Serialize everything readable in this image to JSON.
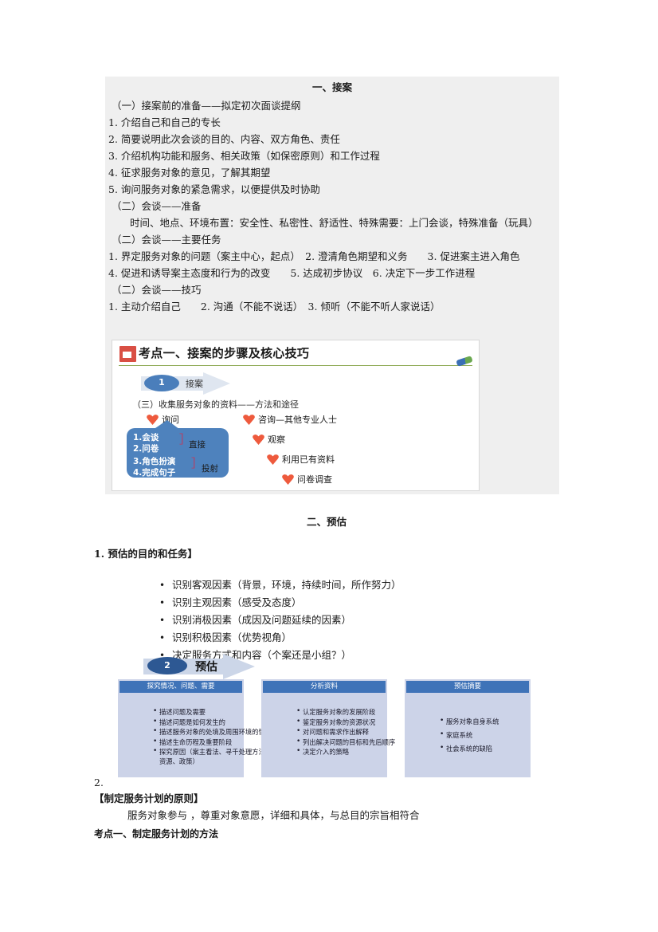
{
  "section1": {
    "title": "一、接案",
    "lines": [
      "（一）接案前的准备——拟定初次面谈提纲",
      "1. 介绍自己和自己的专长",
      "2. 简要说明此次会谈的目的、内容、双方角色、责任",
      "3. 介绍机构功能和服务、相关政策（如保密原则）和工作过程",
      "4. 征求服务对象的意见，了解其期望",
      "5. 询问服务对象的紧急需求，以便提供及时协助",
      "（二）会谈——准备",
      "时间、地点、环境布置：安全性、私密性、舒适性、特殊需要：上门会谈，特殊准备（玩具）",
      "（二）会谈——主要任务",
      "1. 界定服务对象的问题（案主中心，起点）　2. 澄清角色期望和义务　　3. 促进案主进入角色",
      "4. 促进和诱导案主态度和行为的改变　　5. 达成初步协议　6. 决定下一步工作进程",
      "（二）会谈——技巧",
      "1. 主动介绍自己　　2. 沟通（不能不说话）　3. 倾听（不能不听人家说话）"
    ]
  },
  "slide1": {
    "title": "考点一、接案的步骤及核心技巧",
    "step_number": "1",
    "step_label": "接案",
    "subtitle": "（三）收集服务对象的资料——方法和途径",
    "heart_items": [
      "询问",
      "咨询—其他专业人士",
      "观察",
      "利用已有资料",
      "问卷调查"
    ],
    "callout": {
      "lines": [
        "1.会谈",
        "2.问卷",
        "3.角色扮演",
        "4.完成句子"
      ],
      "bracket_glyph": "］",
      "side_labels": [
        "直接",
        "投射"
      ]
    }
  },
  "section2": {
    "title": "二、预估",
    "heading": "1. 预估的目的和任务】",
    "bullets": [
      "识别客观因素（背景，环境，持续时间，所作努力）",
      "识别主观因素（感受及态度）",
      "识别消极因素（成因及问题延续的因素）",
      "识别积极因素（优势视角）",
      "决定服务方式和内容（个案还是小组？）"
    ]
  },
  "slide2": {
    "step_number": "2",
    "step_label": "预估",
    "columns": [
      {
        "header": "探究情况、问题、需要",
        "items": [
          "描述问题及需要",
          "描述问题是如何发生的",
          "描述服务对象的处境及周围环境的情况",
          "描述生命历程及重要阶段",
          "探究原因（案主看法、寻千处理方法、资源、政策）"
        ]
      },
      {
        "header": "分析资料",
        "items": [
          "认定服务对象的发展阶段",
          "鉴定服务对象的资源状况",
          "对问题和需求作出解释",
          "列出解决问题的目标和先后顺序",
          "决定介入的策略"
        ]
      },
      {
        "header": "预估摘要",
        "items": [
          "服务对象自身系统",
          "家庭系统",
          "社会系统的缺陷"
        ]
      }
    ]
  },
  "section3": {
    "number": "2.",
    "heading": "【制定服务计划的原则】",
    "body": "服务对象参与 ，尊重对象意愿，详细和具体，与总目的宗旨相符合",
    "footer": "考点一、制定服务计划的方法"
  }
}
